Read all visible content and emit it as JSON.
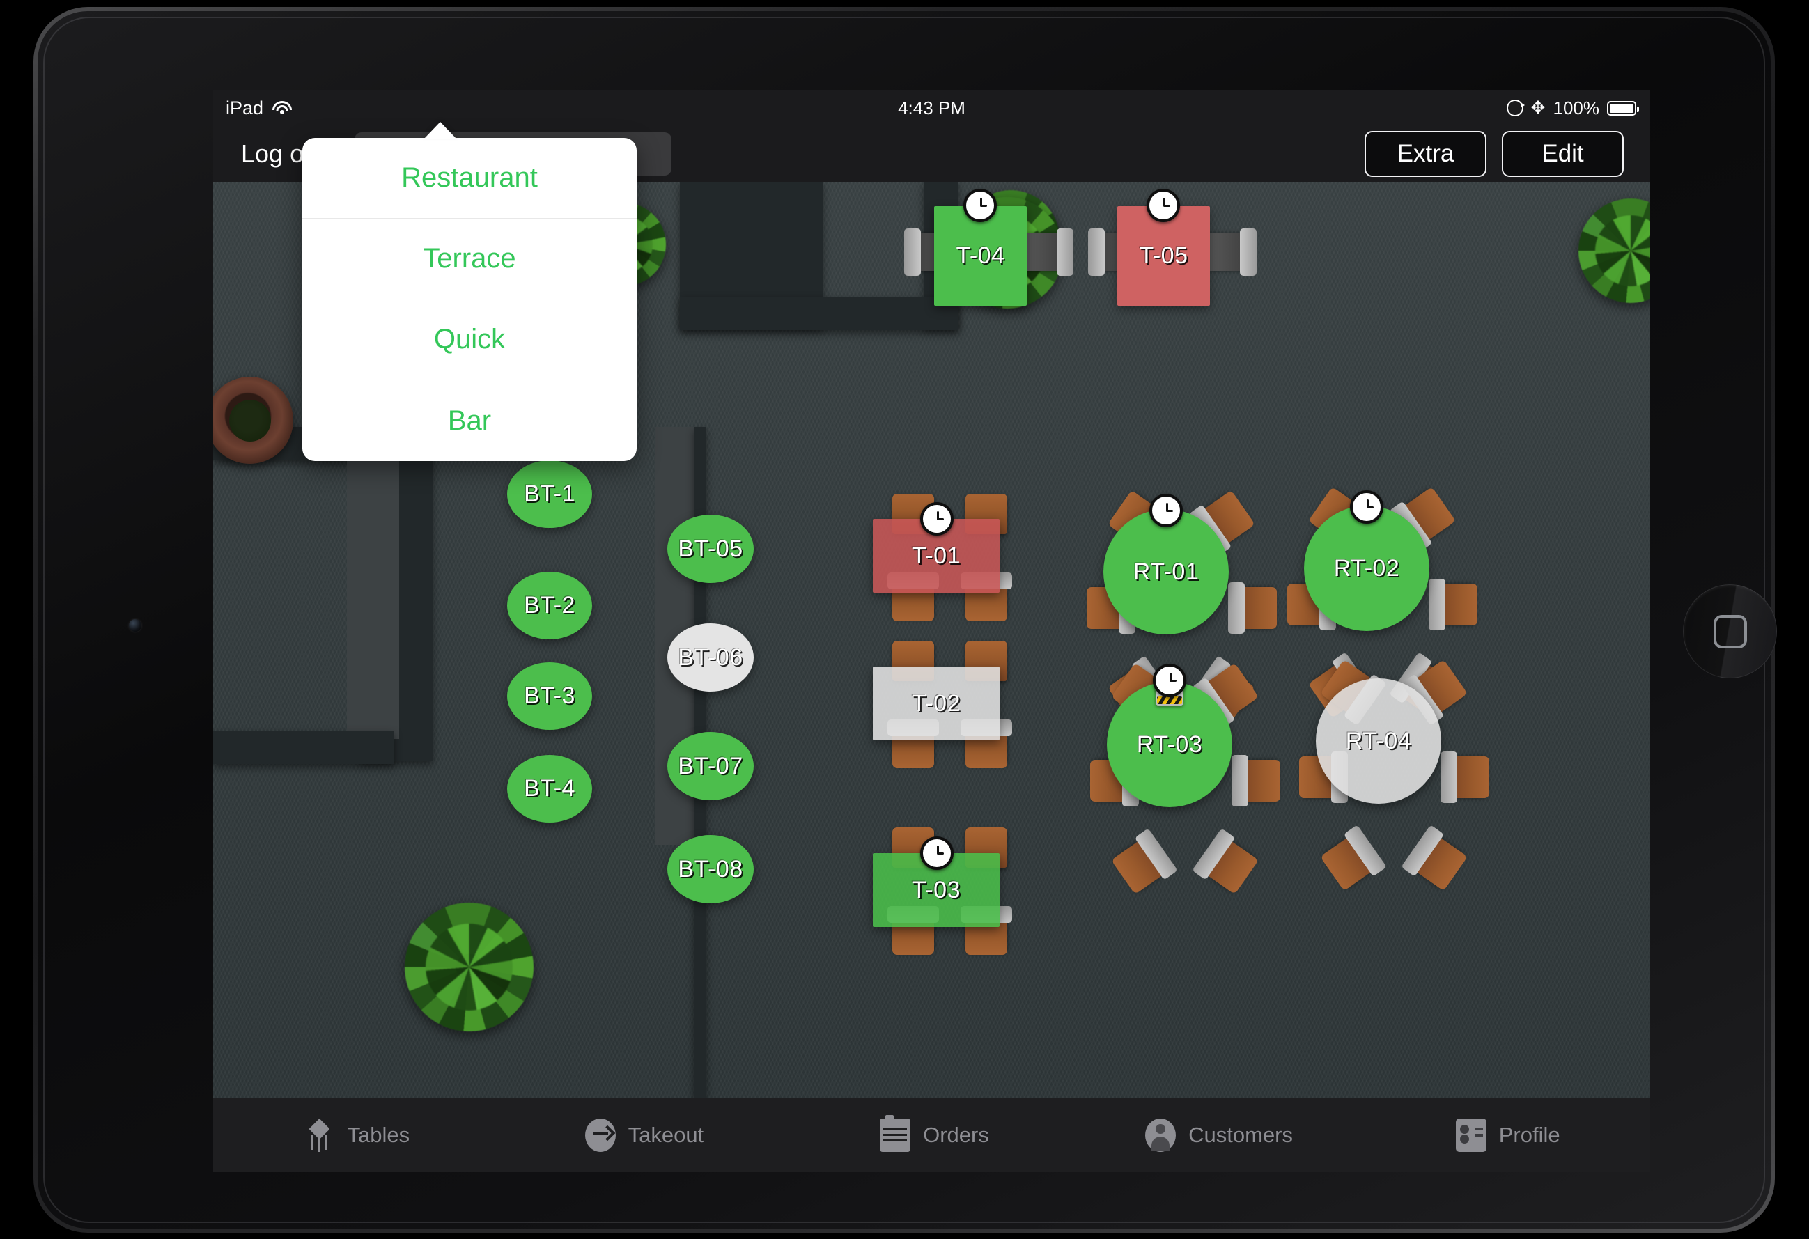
{
  "status_bar": {
    "device": "iPad",
    "wifi_icon": "wifi-icon",
    "time": "4:43 PM",
    "rotation_lock_icon": "rotation-lock-icon",
    "bluetooth_icon": "bluetooth-icon",
    "battery_percent": "100%",
    "battery_icon": "battery-full-icon"
  },
  "nav": {
    "logout": "Log out",
    "floor_selector": "Floor: Restaurant",
    "extra": "Extra",
    "edit": "Edit"
  },
  "popover": {
    "items": [
      {
        "label": "Restaurant"
      },
      {
        "label": "Terrace"
      },
      {
        "label": "Quick"
      },
      {
        "label": "Bar"
      }
    ]
  },
  "floor": {
    "tables": [
      {
        "label": "T-04",
        "shape": "rect",
        "status": "open",
        "badge": "clock"
      },
      {
        "label": "T-05",
        "shape": "rect",
        "status": "busy",
        "badge": "clock"
      },
      {
        "label": "BT-1",
        "shape": "oval",
        "status": "open",
        "badge": "none"
      },
      {
        "label": "BT-2",
        "shape": "oval",
        "status": "open",
        "badge": "none"
      },
      {
        "label": "BT-3",
        "shape": "oval",
        "status": "open",
        "badge": "none"
      },
      {
        "label": "BT-4",
        "shape": "oval",
        "status": "open",
        "badge": "none"
      },
      {
        "label": "BT-05",
        "shape": "oval",
        "status": "open",
        "badge": "none"
      },
      {
        "label": "BT-06",
        "shape": "oval",
        "status": "free",
        "badge": "none"
      },
      {
        "label": "BT-07",
        "shape": "oval",
        "status": "open",
        "badge": "none"
      },
      {
        "label": "BT-08",
        "shape": "oval",
        "status": "open",
        "badge": "none"
      },
      {
        "label": "T-01",
        "shape": "rect",
        "status": "busy",
        "badge": "clock"
      },
      {
        "label": "T-02",
        "shape": "rect",
        "status": "free",
        "badge": "none"
      },
      {
        "label": "T-03",
        "shape": "rect",
        "status": "open",
        "badge": "clock"
      },
      {
        "label": "RT-01",
        "shape": "round",
        "status": "open",
        "badge": "clock"
      },
      {
        "label": "RT-02",
        "shape": "round",
        "status": "open",
        "badge": "clock"
      },
      {
        "label": "RT-03",
        "shape": "round",
        "status": "open",
        "badge": "clock-print"
      },
      {
        "label": "RT-04",
        "shape": "round",
        "status": "free",
        "badge": "none"
      }
    ],
    "status_colors": {
      "open": "#4cbe4c",
      "busy": "#cf6262",
      "free": "#e4e4e4"
    }
  },
  "tab_bar": {
    "tabs": [
      {
        "label": "Tables",
        "icon": "tables-icon"
      },
      {
        "label": "Takeout",
        "icon": "takeout-icon"
      },
      {
        "label": "Orders",
        "icon": "orders-icon"
      },
      {
        "label": "Customers",
        "icon": "customers-icon"
      },
      {
        "label": "Profile",
        "icon": "profile-icon"
      }
    ]
  }
}
